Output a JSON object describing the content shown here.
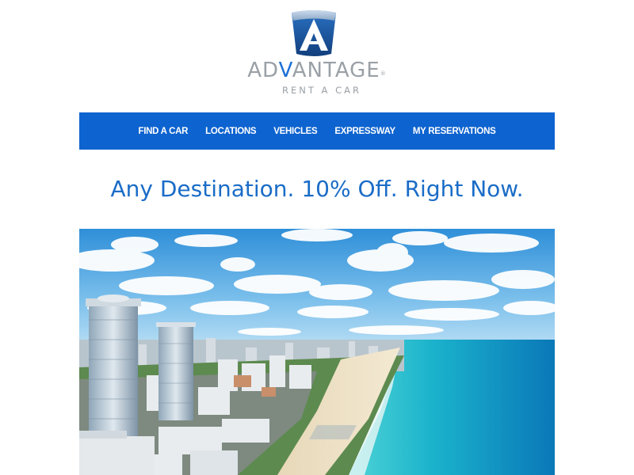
{
  "brand": {
    "name_prefix": "AD",
    "name_accent": "V",
    "name_suffix": "ANTAGE",
    "registered_mark": "®",
    "tagline": "RENT A CAR",
    "logo_icon": "a-triangle-logo-icon",
    "colors": {
      "logo_blue": "#1f63b5",
      "logo_grey": "#9aa0a6",
      "accent_blue": "#1c6fd6"
    }
  },
  "nav": {
    "background": "#0d63cf",
    "items": [
      {
        "label": "FIND A CAR"
      },
      {
        "label": "LOCATIONS"
      },
      {
        "label": "VEHICLES"
      },
      {
        "label": "EXPRESSWAY"
      },
      {
        "label": "MY RESERVATIONS"
      }
    ]
  },
  "headline": {
    "text": "Any Destination. 10% Off. Right Now.",
    "color": "#1a6cc7"
  },
  "hero": {
    "image": "miami-beach-coastline-photo"
  }
}
